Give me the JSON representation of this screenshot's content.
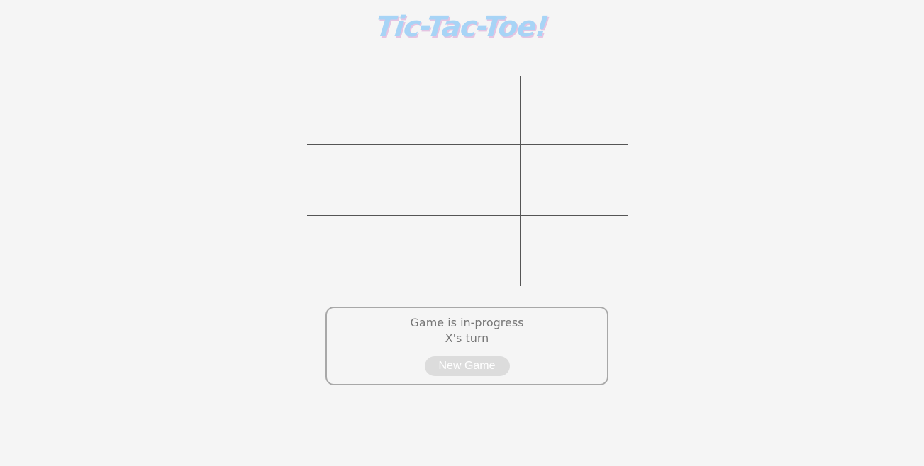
{
  "header": {
    "title": "Tic-Tac-Toe!"
  },
  "board": {
    "cells": [
      "",
      "",
      "",
      "",
      "",
      "",
      "",
      "",
      ""
    ]
  },
  "status": {
    "state_text": "Game is in-progress",
    "turn_text": "X's turn",
    "new_game_label": "New Game"
  },
  "colors": {
    "background": "#f5f5f5",
    "title": "#a7d4f6",
    "title_shadow": "#e4c4e2",
    "grid_line": "#555555",
    "status_border": "#a8a8a8",
    "status_text": "#777777",
    "button_bg": "#dcdcdc",
    "button_text": "#ffffff"
  }
}
